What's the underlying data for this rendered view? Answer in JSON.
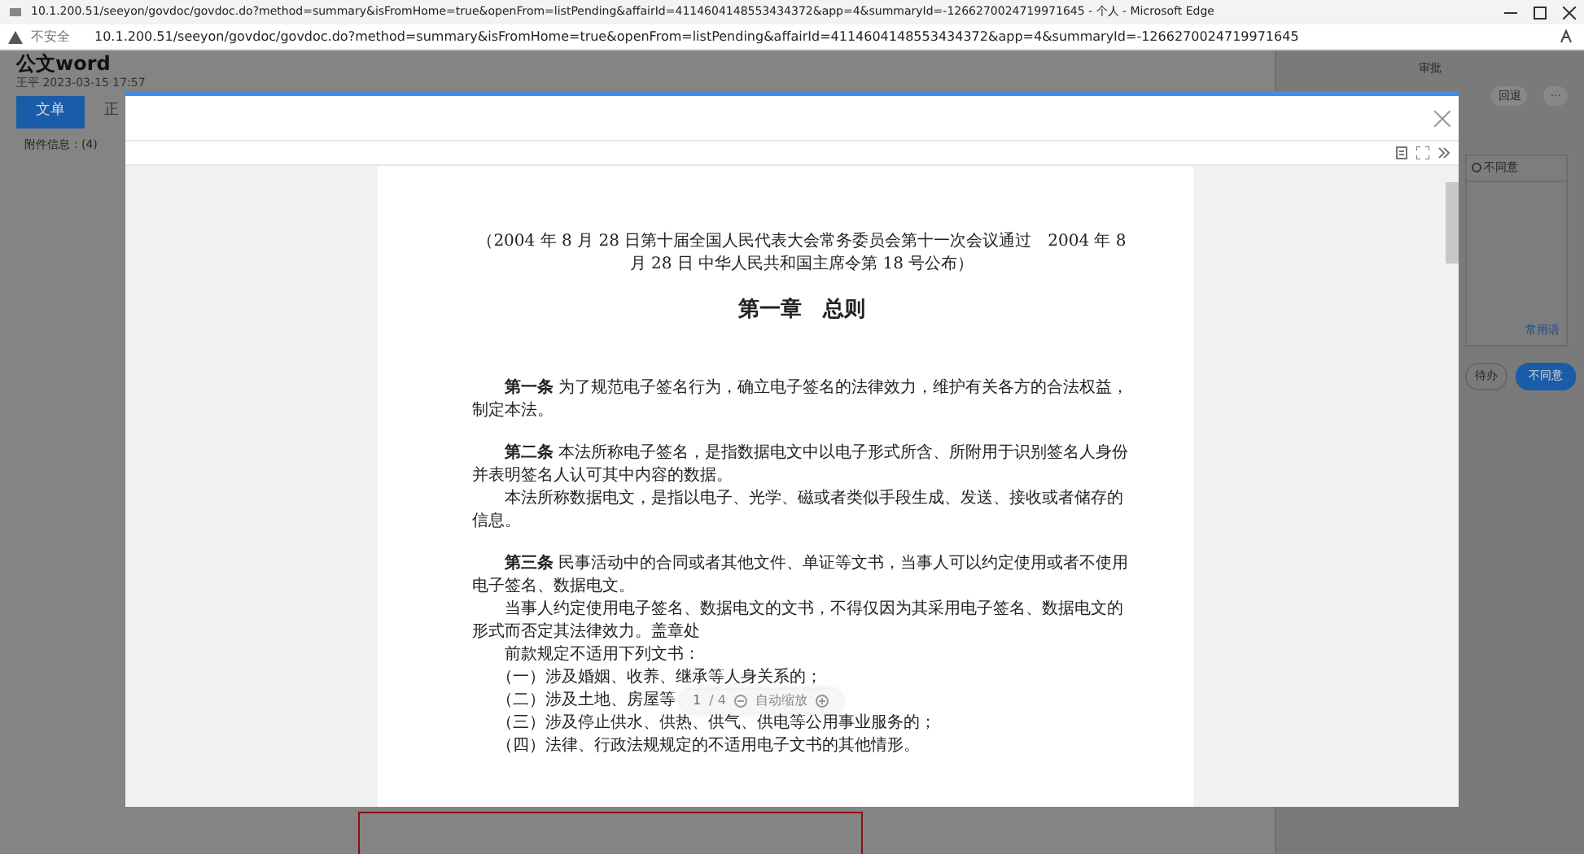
{
  "browser": {
    "title": "10.1.200.51/seeyon/govdoc/govdoc.do?method=summary&isFromHome=true&openFrom=listPending&affairId=4114604148553434372&app=4&summaryId=-1266270024719971645 - 个人 - Microsoft Edge",
    "security": "不安全",
    "url": "10.1.200.51/seeyon/govdoc/govdoc.do?method=summary&isFromHome=true&openFrom=listPending&affairId=4114604148553434372&app=4&summaryId=-1266270024719971645"
  },
  "page": {
    "title": "公文word",
    "meta": "王平 2023-03-15 17:57",
    "tabs": [
      {
        "label": "文单",
        "selected": true
      },
      {
        "label": "正",
        "selected": false
      }
    ],
    "attachments": "附件信息：(4)",
    "panel": {
      "title": "审批",
      "back": "回退",
      "more": "···",
      "option": {
        "label": "不同意",
        "selected": false
      },
      "phrases": "常用语",
      "save": "待办",
      "submit": "不同意"
    }
  },
  "viewer": {
    "pager": {
      "page": "1",
      "total": "/ 4",
      "zoom": "自动缩放"
    },
    "blocks": [
      {
        "kind": "preface",
        "text": "（2004 年 8 月 28 日第十届全国人民代表大会常务委员会第十一次会议通过　2004 年 8 月 28 日 中华人民共和国主席令第 18 号公布）"
      },
      {
        "kind": "chapter",
        "text": "第一章　总则"
      },
      {
        "kind": "article",
        "text": "**第一条** 为了规范电子签名行为，确立电子签名的法律效力，维护有关各方的合法权益，制定本法。"
      },
      {
        "kind": "article",
        "text": "**第二条** 本法所称电子签名，是指数据电文中以电子形式所含、所附用于识别签名人身份并表明签名人认可其中内容的数据。"
      },
      {
        "kind": "para",
        "text": "本法所称数据电文，是指以电子、光学、磁或者类似手段生成、发送、接收或者储存的信息。"
      },
      {
        "kind": "article",
        "text": "**第三条** 民事活动中的合同或者其他文件、单证等文书，当事人可以约定使用或者不使用电子签名、数据电文。"
      },
      {
        "kind": "para",
        "text": "当事人约定使用电子签名、数据电文的文书，不得仅因为其采用电子签名、数据电文的形式而否定其法律效力。盖章处"
      },
      {
        "kind": "para",
        "text": "前款规定不适用下列文书："
      },
      {
        "kind": "item",
        "text": "（一）涉及婚姻、收养、继承等人身关系的；"
      },
      {
        "kind": "covered",
        "text": "（二）涉及土地、房屋等"
      },
      {
        "kind": "item",
        "text": "（三）涉及停止供水、供热、供气、供电等公用事业服务的；"
      },
      {
        "kind": "item",
        "text": "（四）法律、行政法规规定的不适用电子文书的其他情形。"
      }
    ]
  }
}
